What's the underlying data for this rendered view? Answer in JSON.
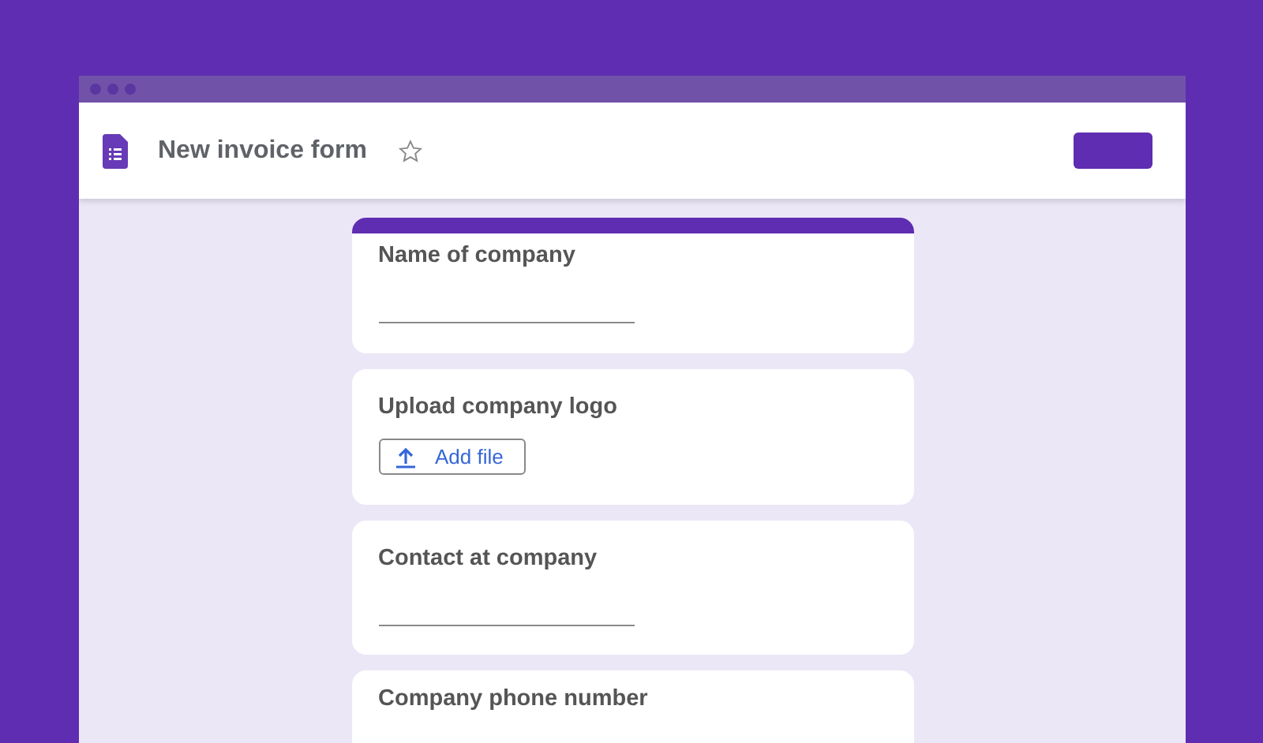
{
  "header": {
    "title": "New invoice form",
    "starred": false
  },
  "questions": [
    {
      "kind": "text",
      "label": "Name of company"
    },
    {
      "kind": "upload",
      "label": "Upload company logo",
      "button": "Add file"
    },
    {
      "kind": "text",
      "label": "Contact at company"
    },
    {
      "kind": "text",
      "label": "Company phone number"
    }
  ]
}
